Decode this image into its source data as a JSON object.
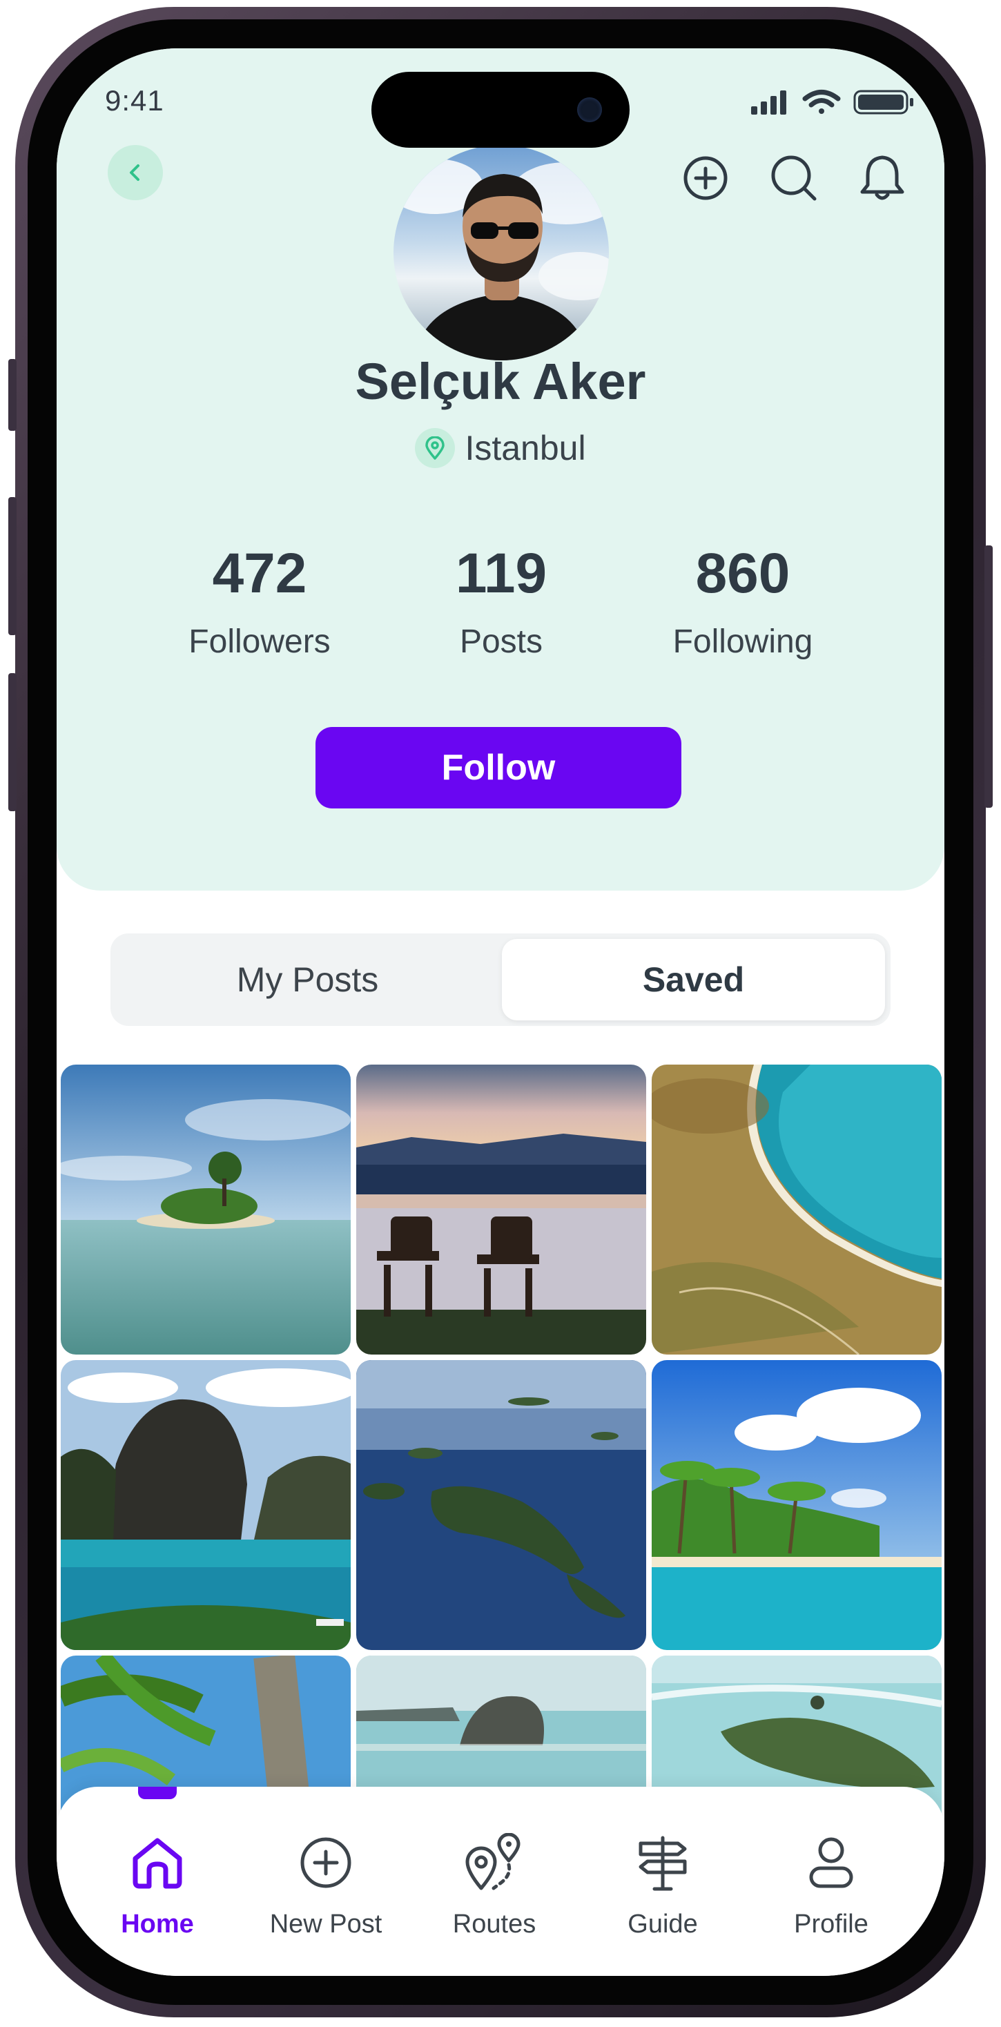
{
  "status_bar": {
    "time": "9:41"
  },
  "profile": {
    "name": "Selçuk Aker",
    "location": "Istanbul"
  },
  "stats": [
    {
      "value": "472",
      "label": "Followers"
    },
    {
      "value": "119",
      "label": "Posts"
    },
    {
      "value": "860",
      "label": "Following"
    }
  ],
  "follow_label": "Follow",
  "tabs": {
    "my_posts": "My Posts",
    "saved": "Saved",
    "active": "Saved"
  },
  "nav": [
    {
      "label": "Home",
      "icon": "home-icon",
      "active": true
    },
    {
      "label": "New Post",
      "icon": "plus-circle-icon",
      "active": false
    },
    {
      "label": "Routes",
      "icon": "route-pin-icon",
      "active": false
    },
    {
      "label": "Guide",
      "icon": "signpost-icon",
      "active": false
    },
    {
      "label": "Profile",
      "icon": "user-icon",
      "active": false
    }
  ],
  "colors": {
    "accent": "#6a06f2",
    "header_bg": "#e3f5f0",
    "mint": "#c8eede",
    "text": "#2f3a44",
    "pin": "#2fc28a"
  }
}
